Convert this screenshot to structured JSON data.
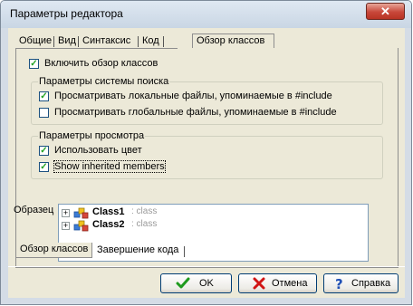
{
  "window": {
    "title": "Параметры редактора",
    "close_label": "✕"
  },
  "tabs": [
    "Общие",
    "Вид",
    "Синтаксис",
    "Код",
    "Обзор классов"
  ],
  "enable_browser": {
    "label": "Включить обзор классов",
    "checked": true
  },
  "search_group": {
    "title": "Параметры системы поиска",
    "items": [
      {
        "label": "Просматривать локальные файлы, упоминаемые в #include",
        "checked": true
      },
      {
        "label": "Просматривать глобальные файлы, упоминаемые в #include",
        "checked": false
      }
    ]
  },
  "view_group": {
    "title": "Параметры просмотра",
    "items": [
      {
        "label": "Использовать цвет",
        "checked": true
      },
      {
        "label": "Show inherited members",
        "checked": true
      }
    ]
  },
  "sample": {
    "label": "Образец",
    "tree": [
      {
        "name": "Class1",
        "type": ": class"
      },
      {
        "name": "Class2",
        "type": ": class"
      }
    ]
  },
  "bottom_tabs": [
    "Обзор классов",
    "Завершение кода"
  ],
  "buttons": {
    "ok": "OK",
    "cancel": "Отмена",
    "help": "Справка"
  },
  "colors": {
    "ok_icon": "#1e9a1e",
    "cancel_icon": "#d11515",
    "help_icon": "#1f4fb5",
    "check_mark": "#21a121"
  }
}
